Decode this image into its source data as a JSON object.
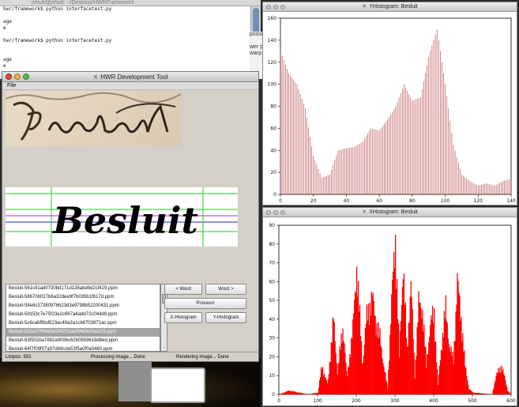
{
  "terminal": {
    "title": "jshutt@jshutt: ~/Desktop/HWRFramework",
    "lines": [
      "hwr/framework$ python interfacetest.py",
      "",
      "age",
      "e",
      "",
      "hwr/framework$ python interfacetest.py",
      "",
      "",
      "age",
      "e"
    ]
  },
  "side_strip": {
    "lines": [
      "possil",
      "",
      "wer p",
      "warp"
    ]
  },
  "hwr": {
    "title": "HWR Development Tool",
    "menu": "File",
    "word_text": "Besluit",
    "files": [
      "Besluit-561c91ad0730bd171d126abdbe2cf429.ppm",
      "Besluit-58670b027b6a32dee9f7b035b1f617d.ppm",
      "Besluit-58e8c37380976623d3e9798b52200431.ppm",
      "Besluit-59153c7e75f23e2c667a4add72c04dd9.ppm",
      "Besluit-5c6ca6f9bd523ac49a3a1cb6703871ac.ppm",
      "Besluit-5d1e27f04d2e004202aef54d3e3aa2c5.ppm",
      "Besluit-63f502ba7882a909bc6260959618d8ed.ppm",
      "Besluit-64f7f09f07a97db9cde53f5a0f0a0480.ppm"
    ],
    "selected_index": 5,
    "buttons": {
      "prev_word": "< Word",
      "next_word": "Word >",
      "process": "Process!",
      "x_hist": "X-Histogram",
      "y_hist": "Y-Histogram"
    },
    "status": {
      "pixels": "Listpos: 933",
      "processing": "Processing image... Done",
      "rendering": "Rendering image... Done"
    }
  },
  "yhist": {
    "title": "YHistogram: Besluit"
  },
  "xhist": {
    "title": "XHistogram: Besluit"
  },
  "chart_data": [
    {
      "type": "bar",
      "title": "YHistogram: Besluit",
      "xlim": [
        0,
        140
      ],
      "ylim": [
        0,
        160
      ],
      "xticks": [
        0,
        20,
        40,
        60,
        80,
        100,
        120,
        140
      ],
      "yticks": [
        0,
        20,
        40,
        60,
        80,
        100,
        120,
        140,
        160
      ],
      "x": [
        0,
        5,
        10,
        15,
        20,
        25,
        30,
        35,
        40,
        45,
        50,
        55,
        60,
        65,
        70,
        75,
        80,
        85,
        90,
        95,
        100,
        105,
        110,
        115,
        120,
        125,
        130,
        135,
        140
      ],
      "values": [
        130,
        110,
        100,
        78,
        35,
        15,
        18,
        40,
        42,
        43,
        48,
        60,
        58,
        68,
        80,
        100,
        85,
        88,
        125,
        150,
        100,
        45,
        18,
        12,
        8,
        10,
        8,
        12,
        14
      ],
      "color": "#b03030"
    },
    {
      "type": "bar",
      "title": "XHistogram: Besluit",
      "xlim": [
        0,
        600
      ],
      "ylim": [
        0,
        90
      ],
      "xticks": [
        0,
        100,
        200,
        300,
        400,
        500,
        600
      ],
      "yticks": [
        0,
        10,
        20,
        30,
        40,
        50,
        60,
        70,
        80,
        90
      ],
      "x": [
        0,
        25,
        50,
        75,
        100,
        110,
        125,
        140,
        150,
        165,
        175,
        190,
        200,
        215,
        225,
        240,
        250,
        260,
        270,
        280,
        290,
        300,
        310,
        320,
        330,
        340,
        350,
        360,
        370,
        380,
        390,
        400,
        410,
        420,
        430,
        440,
        450,
        460,
        470,
        480,
        490,
        500,
        550,
        560,
        575,
        590,
        600
      ],
      "values": [
        0,
        2,
        1,
        0,
        1,
        15,
        5,
        40,
        12,
        36,
        8,
        35,
        68,
        15,
        40,
        52,
        38,
        30,
        15,
        3,
        50,
        82,
        20,
        70,
        22,
        60,
        10,
        48,
        45,
        15,
        38,
        42,
        5,
        28,
        45,
        25,
        18,
        60,
        40,
        15,
        3,
        1,
        0,
        10,
        15,
        2,
        0
      ],
      "color": "#ff0000"
    }
  ]
}
